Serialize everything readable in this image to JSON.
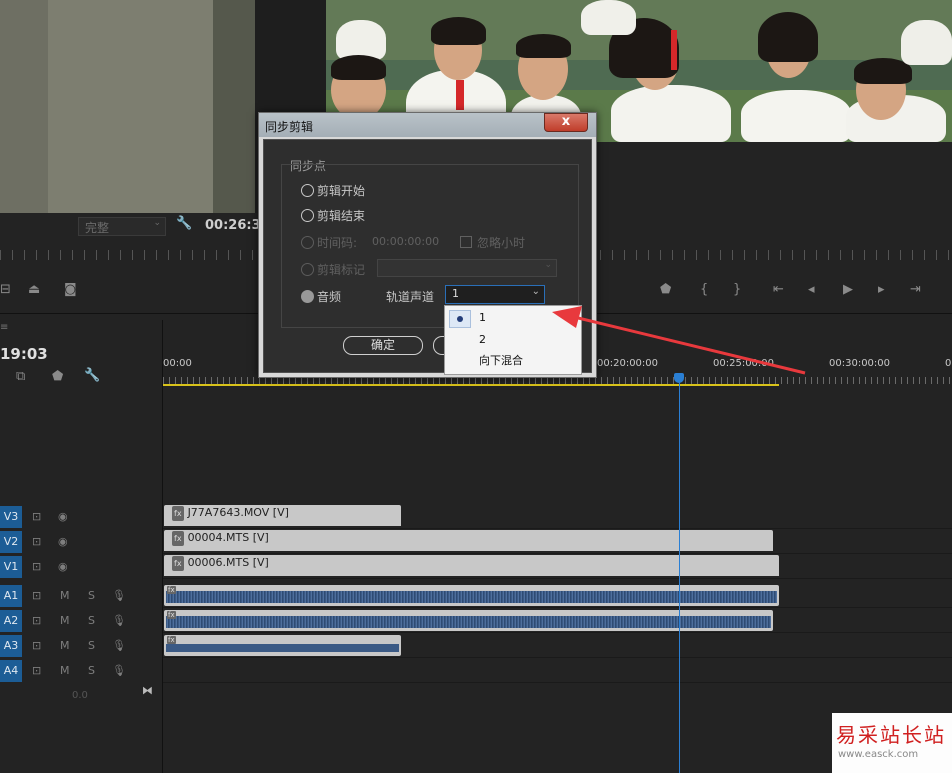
{
  "source_monitor": {
    "fit_label": "完整",
    "timecode": "00:26:3"
  },
  "timeline": {
    "timecode": "19:03",
    "ruler": [
      "00:00",
      "00:20:00:00",
      "00:25:00:00",
      "00:30:00:00",
      "0"
    ],
    "tracks": {
      "video": [
        {
          "label": "V3",
          "clip": "J77A7643.MOV [V]"
        },
        {
          "label": "V2",
          "clip": "00004.MTS [V]"
        },
        {
          "label": "V1",
          "clip": "00006.MTS [V]"
        }
      ],
      "audio": [
        {
          "label": "A1",
          "m": "M",
          "s": "S"
        },
        {
          "label": "A2",
          "m": "M",
          "s": "S"
        },
        {
          "label": "A3",
          "m": "M",
          "s": "S"
        },
        {
          "label": "A4",
          "m": "M",
          "s": "S"
        }
      ],
      "mix_value": "0.0"
    },
    "fx_badge": "fx"
  },
  "dialog": {
    "title": "同步剪辑",
    "close": "x",
    "group_label": "同步点",
    "options": {
      "clip_start": "剪辑开始",
      "clip_end": "剪辑结束",
      "timecode": "时间码:",
      "timecode_value": "00:00:00:00",
      "ignore_hours": "忽略小时",
      "clip_marker": "剪辑标记",
      "audio": "音频",
      "track_channel": "轨道声道",
      "track_channel_value": "1"
    },
    "ok": "确定"
  },
  "dropdown": {
    "items": [
      "1",
      "2",
      "向下混合"
    ],
    "selected": "1"
  },
  "watermark": {
    "title": "易采站长站",
    "url": "www.easck.com"
  },
  "colors": {
    "accent_blue": "#1c5d96",
    "arrow_red": "#e8393d",
    "playhead": "#2a7fd4",
    "work_area": "#d8c21a"
  }
}
